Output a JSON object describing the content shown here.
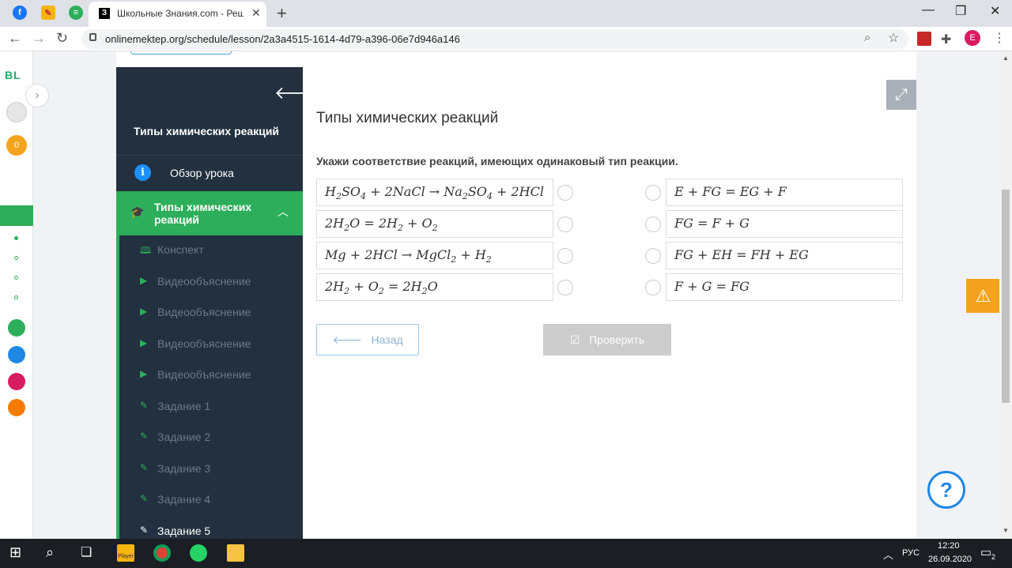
{
  "browser": {
    "tab_title": "Школьные Знания.com - Решае",
    "tab_favicon_letter": "З",
    "url": "onlinemektep.org/schedule/lesson/2a3a4515-1614-4d79-a396-06e7d946a146",
    "profile_letter": "E"
  },
  "rail": {
    "logo": "BL",
    "badge_count": "0"
  },
  "sidebar": {
    "title": "Типы химических реакций",
    "overview_label": "Обзор урока",
    "active_section": "Типы химических реакций",
    "items": [
      {
        "icon": "book-icon",
        "label": "Конспект"
      },
      {
        "icon": "play-icon",
        "label": "Видеообъяснение"
      },
      {
        "icon": "play-icon",
        "label": "Видеообъяснение"
      },
      {
        "icon": "play-icon",
        "label": "Видеообъяснение"
      },
      {
        "icon": "play-icon",
        "label": "Видеообъяснение"
      },
      {
        "icon": "edit-icon",
        "label": "Задание 1"
      },
      {
        "icon": "edit-icon",
        "label": "Задание 2"
      },
      {
        "icon": "edit-icon",
        "label": "Задание 3"
      },
      {
        "icon": "edit-icon",
        "label": "Задание 4"
      },
      {
        "icon": "edit-icon",
        "label": "Задание 5",
        "current": true
      }
    ]
  },
  "main": {
    "title": "Типы химических реакций",
    "instruction": "Укажи соответствие реакций, имеющих одинаковый тип реакции.",
    "left_equations": [
      "H2SO4 + 2NaCl → Na2SO4 + 2HCl",
      "2H2O = 2H2 + O2",
      "Mg + 2HCl → MgCl2 + H2",
      "2H2 + O2 = 2H2O"
    ],
    "right_equations": [
      "E + FG = EG + F",
      "FG = F + G",
      "FG + EH = FH + EG",
      "F + G = FG"
    ],
    "back_label": "Назад",
    "check_label": "Проверить"
  },
  "taskbar": {
    "lang": "РУС",
    "time": "12:20",
    "date": "26.09.2020",
    "player_label": "Player",
    "notif_count": "2"
  },
  "colors": {
    "sidebar_bg": "#22303f",
    "accent_green": "#2dae5a",
    "warning": "#f4a31e",
    "help_blue": "#1e88e5"
  }
}
